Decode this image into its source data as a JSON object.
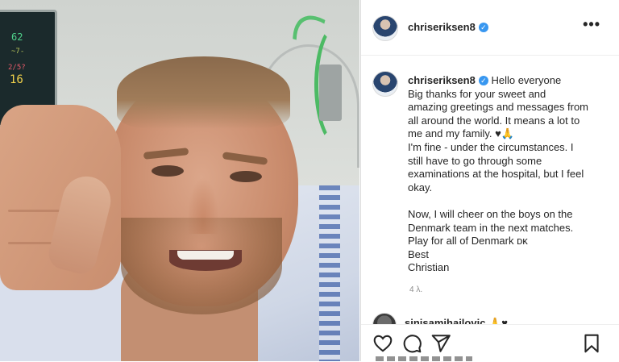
{
  "photo": {
    "monitor_readings": [
      "62",
      "~7-",
      "2/5?",
      "16"
    ]
  },
  "post": {
    "author": "chriseriksen8",
    "verified": true,
    "more_label": "•••"
  },
  "caption": {
    "author": "chriseriksen8",
    "lines": [
      "Hello everyone",
      "Big thanks for your sweet and",
      "amazing greetings and messages from",
      "all around the world. It means a lot to",
      "me and my family. ♥🙏",
      "I'm fine - under the circumstances. I",
      "still have to go through some",
      "examinations at the hospital, but I feel",
      "okay.",
      "",
      "Now, I will cheer on the boys on the",
      "Denmark team in the next matches.",
      "Play for all of Denmark ᴅᴋ",
      "Best",
      "Christian"
    ],
    "time_ago": "4 λ."
  },
  "comments": [
    {
      "author": "sinisamihajlovic",
      "text": "🙏♥"
    }
  ],
  "actions": {
    "like": "heart-icon",
    "comment": "comment-icon",
    "share": "send-icon",
    "save": "bookmark-icon"
  },
  "colors": {
    "verified": "#3897f0",
    "text": "#262626",
    "muted": "#8e8e8e",
    "border": "#dbdbdb"
  }
}
